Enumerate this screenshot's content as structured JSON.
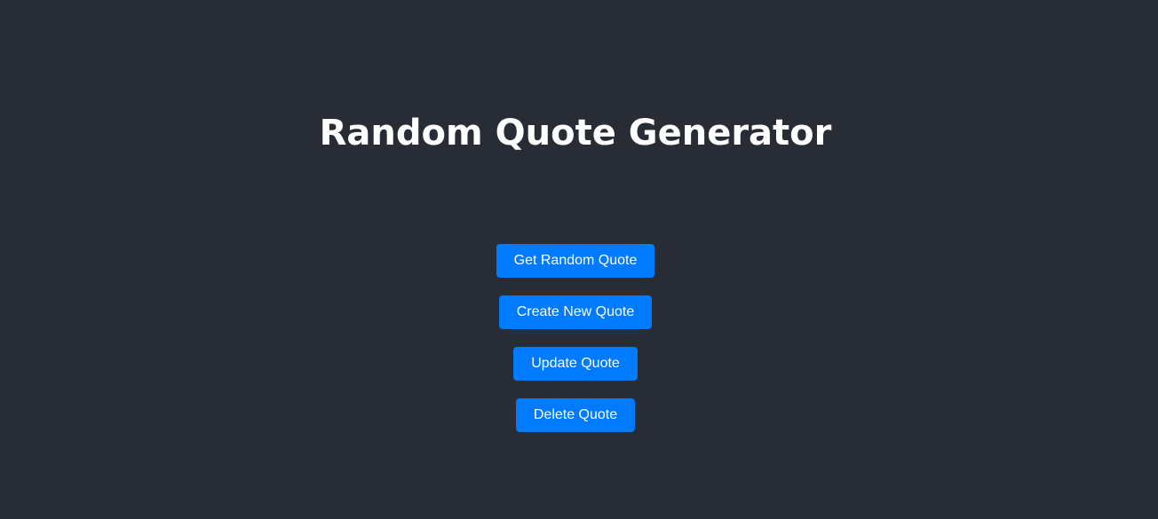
{
  "page": {
    "title": "Random Quote Generator",
    "background_color": "#282c34",
    "text_color": "#ffffff"
  },
  "actions": {
    "accent_color": "#007bff",
    "buttons": [
      {
        "label": "Get Random Quote"
      },
      {
        "label": "Create New Quote"
      },
      {
        "label": "Update Quote"
      },
      {
        "label": "Delete Quote"
      }
    ]
  }
}
